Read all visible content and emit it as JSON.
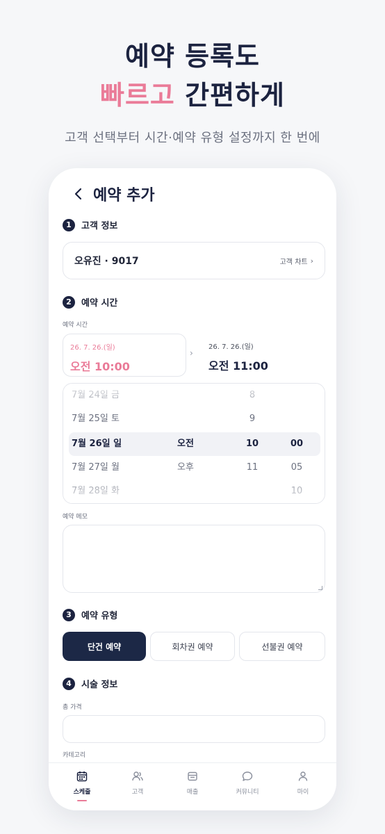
{
  "hero": {
    "line1": "예약 등록도",
    "line2_accent": "빠르고",
    "line2_rest": "간편하게",
    "subtitle": "고객 선택부터 시간·예약 유형 설정까지 한 번에"
  },
  "screen": {
    "title": "예약 추가",
    "back_icon": "chevron-left-icon",
    "sections": {
      "customer": {
        "number": "1",
        "title": "고객 정보"
      },
      "time": {
        "number": "2",
        "title": "예약 시간"
      },
      "type": {
        "number": "3",
        "title": "예약 유형"
      },
      "treatment": {
        "number": "4",
        "title": "시술 정보"
      }
    },
    "customer": {
      "name": "오유진 · 9017",
      "chart_link": "고객 차트",
      "chart_chevron": "›"
    },
    "time": {
      "label": "예약 시간",
      "start": {
        "date": "26. 7. 26.(일)",
        "time": "오전 10:00"
      },
      "separator": "›",
      "end": {
        "date": "26. 7. 26.(일)",
        "time": "오전 11:00"
      },
      "picker_rows": [
        {
          "date": "7월 24일 금",
          "ampm": "",
          "hour": "8",
          "minute": ""
        },
        {
          "date": "7월 25일 토",
          "ampm": "",
          "hour": "9",
          "minute": ""
        },
        {
          "date": "7월 26일 일",
          "ampm": "오전",
          "hour": "10",
          "minute": "00"
        },
        {
          "date": "7월 27일 월",
          "ampm": "오후",
          "hour": "11",
          "minute": "05"
        },
        {
          "date": "7월 28일 화",
          "ampm": "",
          "hour": "",
          "minute": "10"
        }
      ],
      "selected_row_index": 2
    },
    "memo": {
      "label": "예약 메모",
      "value": ""
    },
    "type": {
      "options": [
        "단건 예약",
        "회차권 예약",
        "선불권 예약"
      ],
      "selected": "단건 예약"
    },
    "treatment": {
      "total_price_label": "총 가격",
      "total_price_value": "",
      "category_label": "카테고리"
    }
  },
  "tabbar": {
    "items": [
      {
        "label": "스케줄",
        "icon": "calendar-icon",
        "active": true
      },
      {
        "label": "고객",
        "icon": "users-icon",
        "active": false
      },
      {
        "label": "매출",
        "icon": "sales-icon",
        "active": false
      },
      {
        "label": "커뮤니티",
        "icon": "chat-bubble-icon",
        "active": false
      },
      {
        "label": "마이",
        "icon": "person-icon",
        "active": false
      }
    ]
  },
  "colors": {
    "navy": "#1c2340",
    "accent_pink": "#ea7b98",
    "border": "#e4e6ec"
  }
}
